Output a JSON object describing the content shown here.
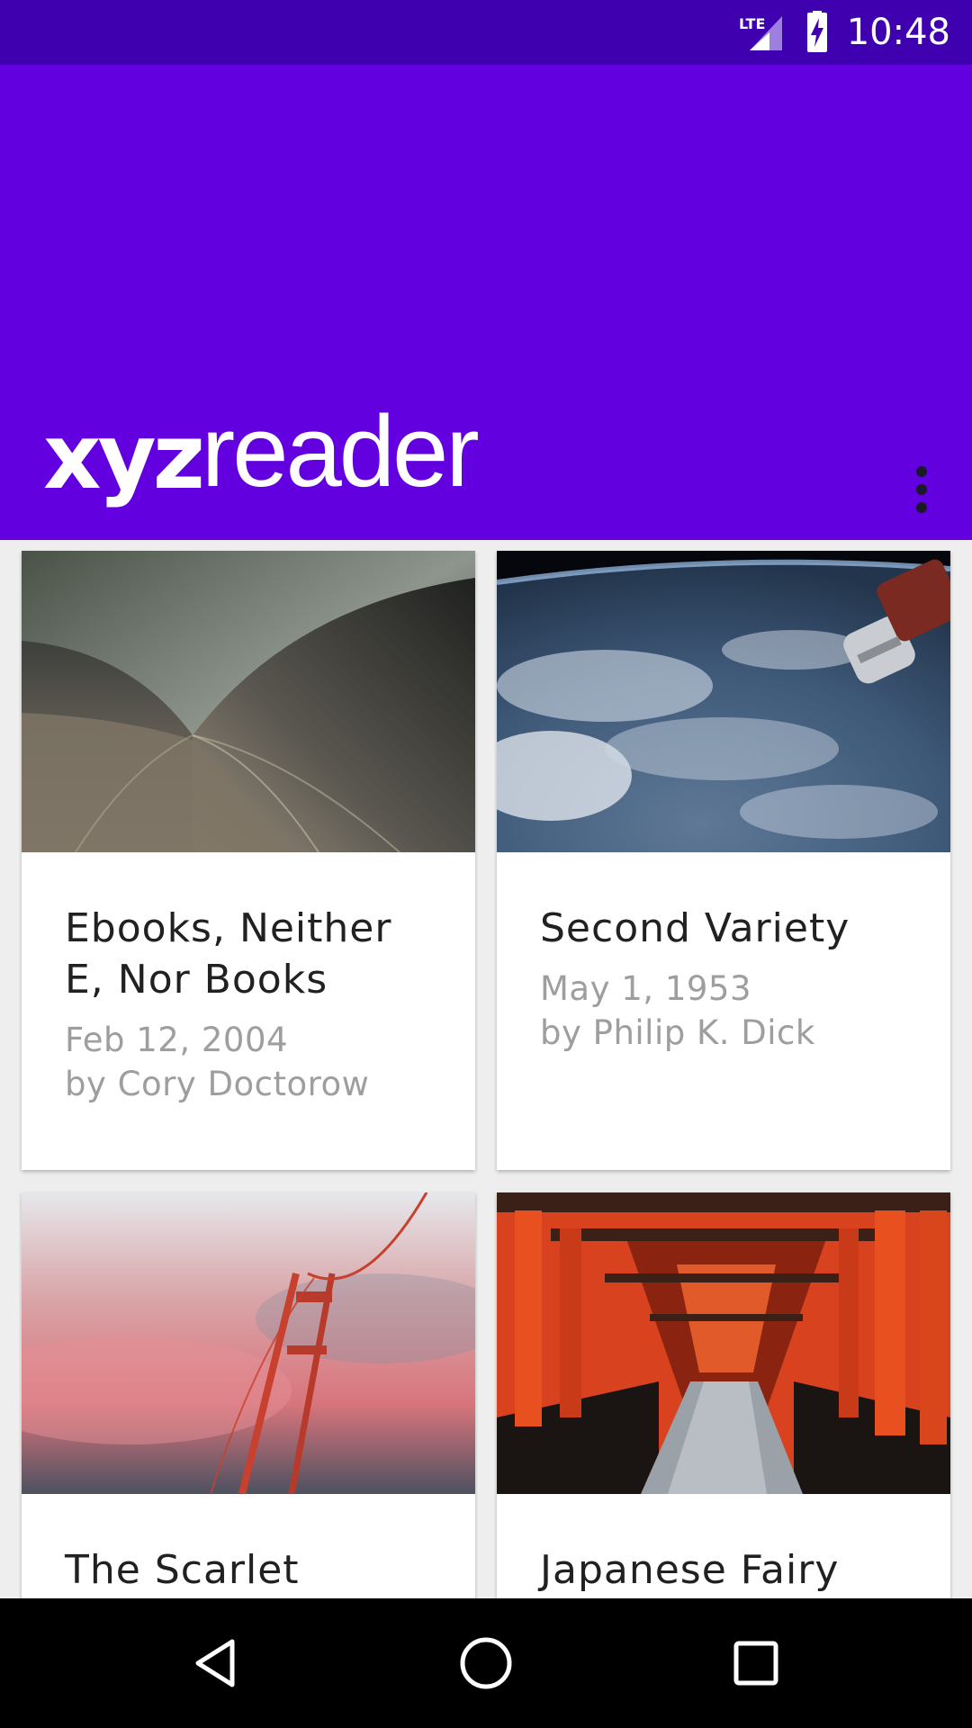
{
  "status_bar": {
    "network": "LTE",
    "time": "10:48",
    "icons": [
      "lte-signal-icon",
      "battery-charging-icon"
    ]
  },
  "app_bar": {
    "logo_part1": "xyz",
    "logo_part2": "reader",
    "menu_icon": "overflow-menu-icon",
    "color": "#6200e0"
  },
  "colors": {
    "status_bar": "#3f00b0",
    "app_bar": "#6200e0",
    "background": "#eeeeee",
    "title_text": "#212121",
    "meta_text": "#9e9e9e"
  },
  "articles": [
    {
      "title_line1": "Ebooks, Neither",
      "title_line2": "E, Nor Books",
      "date": "Feb 12, 2004",
      "author": "by Cory Doctorow",
      "image": "opera-house-roof-image"
    },
    {
      "title_line1": "Second Variety",
      "title_line2": "",
      "date": "May 1, 1953",
      "author": "by Philip K. Dick",
      "image": "earth-space-station-image"
    },
    {
      "title_line1": "The Scarlet",
      "image": "foggy-bridge-image"
    },
    {
      "title_line1": "Japanese Fairy",
      "image": "torii-gates-image"
    }
  ],
  "nav_bar": {
    "back_icon": "back-triangle-icon",
    "home_icon": "home-circle-icon",
    "recents_icon": "recents-square-icon"
  }
}
